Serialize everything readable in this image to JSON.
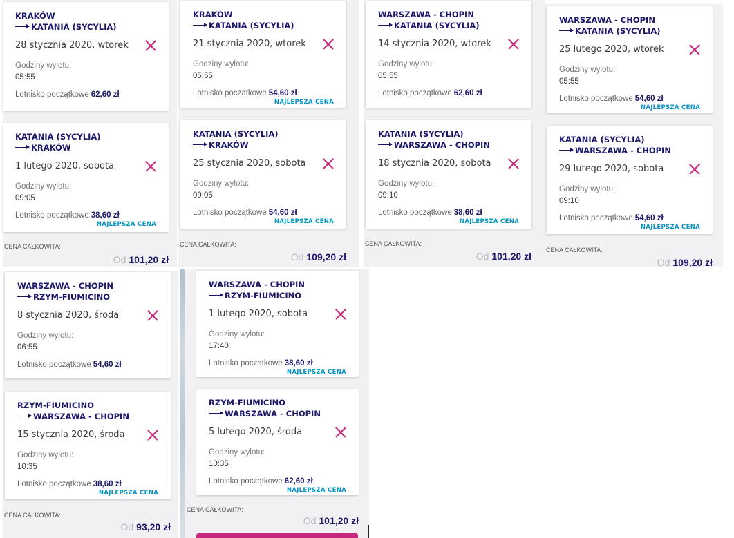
{
  "labels": {
    "departure_hours": "Godziny wylotu:",
    "start_airport": "Lotnisko początkowe",
    "best_price": "NAJLEPSZA CENA",
    "total_price": "CENA CAŁKOWITA:",
    "from": "Od"
  },
  "colors": {
    "route_text": "#1b1769",
    "close_icon": "#c8287c",
    "best_price_badge": "#0097c9",
    "panel_bg": "#f1f1f3"
  },
  "trips": [
    {
      "total": "101,20 zł",
      "outbound": {
        "from": "KRAKÓW",
        "to": "KATANIA (SYCYLIA)",
        "date": "28 stycznia 2020, wtorek",
        "time": "05:55",
        "price": "62,60 zł",
        "best": false
      },
      "inbound": {
        "from": "KATANIA (SYCYLIA)",
        "to": "KRAKÓW",
        "date": "1 lutego 2020, sobota",
        "time": "09:05",
        "price": "38,60 zł",
        "best": true
      }
    },
    {
      "total": "109,20 zł",
      "outbound": {
        "from": "KRAKÓW",
        "to": "KATANIA (SYCYLIA)",
        "date": "21 stycznia 2020, wtorek",
        "time": "05:55",
        "price": "54,60 zł",
        "best": true
      },
      "inbound": {
        "from": "KATANIA (SYCYLIA)",
        "to": "KRAKÓW",
        "date": "25 stycznia 2020, sobota",
        "time": "09:05",
        "price": "54,60 zł",
        "best": true
      }
    },
    {
      "total": "101,20 zł",
      "outbound": {
        "from": "WARSZAWA - CHOPIN",
        "to": "KATANIA (SYCYLIA)",
        "date": "14 stycznia 2020, wtorek",
        "time": "05:55",
        "price": "62,60 zł",
        "best": false
      },
      "inbound": {
        "from": "KATANIA (SYCYLIA)",
        "to": "WARSZAWA - CHOPIN",
        "date": "18 stycznia 2020, sobota",
        "time": "09:10",
        "price": "38,60 zł",
        "best": true
      }
    },
    {
      "total": "109,20 zł",
      "outbound": {
        "from": "WARSZAWA - CHOPIN",
        "to": "KATANIA (SYCYLIA)",
        "date": "25 lutego 2020, wtorek",
        "time": "05:55",
        "price": "54,60 zł",
        "best": true
      },
      "inbound": {
        "from": "KATANIA (SYCYLIA)",
        "to": "WARSZAWA - CHOPIN",
        "date": "29 lutego 2020, sobota",
        "time": "09:10",
        "price": "54,60 zł",
        "best": true
      }
    },
    {
      "total": "93,20 zł",
      "outbound": {
        "from": "WARSZAWA - CHOPIN",
        "to": "RZYM-FIUMICINO",
        "date": "8 stycznia 2020, środa",
        "time": "06:55",
        "price": "54,60 zł",
        "best": false
      },
      "inbound": {
        "from": "RZYM-FIUMICINO",
        "to": "WARSZAWA - CHOPIN",
        "date": "15 stycznia 2020, środa",
        "time": "10:35",
        "price": "38,60 zł",
        "best": true
      }
    },
    {
      "total": "101,20 zł",
      "outbound": {
        "from": "WARSZAWA - CHOPIN",
        "to": "RZYM-FIUMICINO",
        "date": "1 lutego 2020, sobota",
        "time": "17:40",
        "price": "38,60 zł",
        "best": true
      },
      "inbound": {
        "from": "RZYM-FIUMICINO",
        "to": "WARSZAWA - CHOPIN",
        "date": "5 lutego 2020, środa",
        "time": "10:35",
        "price": "62,60 zł",
        "best": true
      }
    }
  ]
}
